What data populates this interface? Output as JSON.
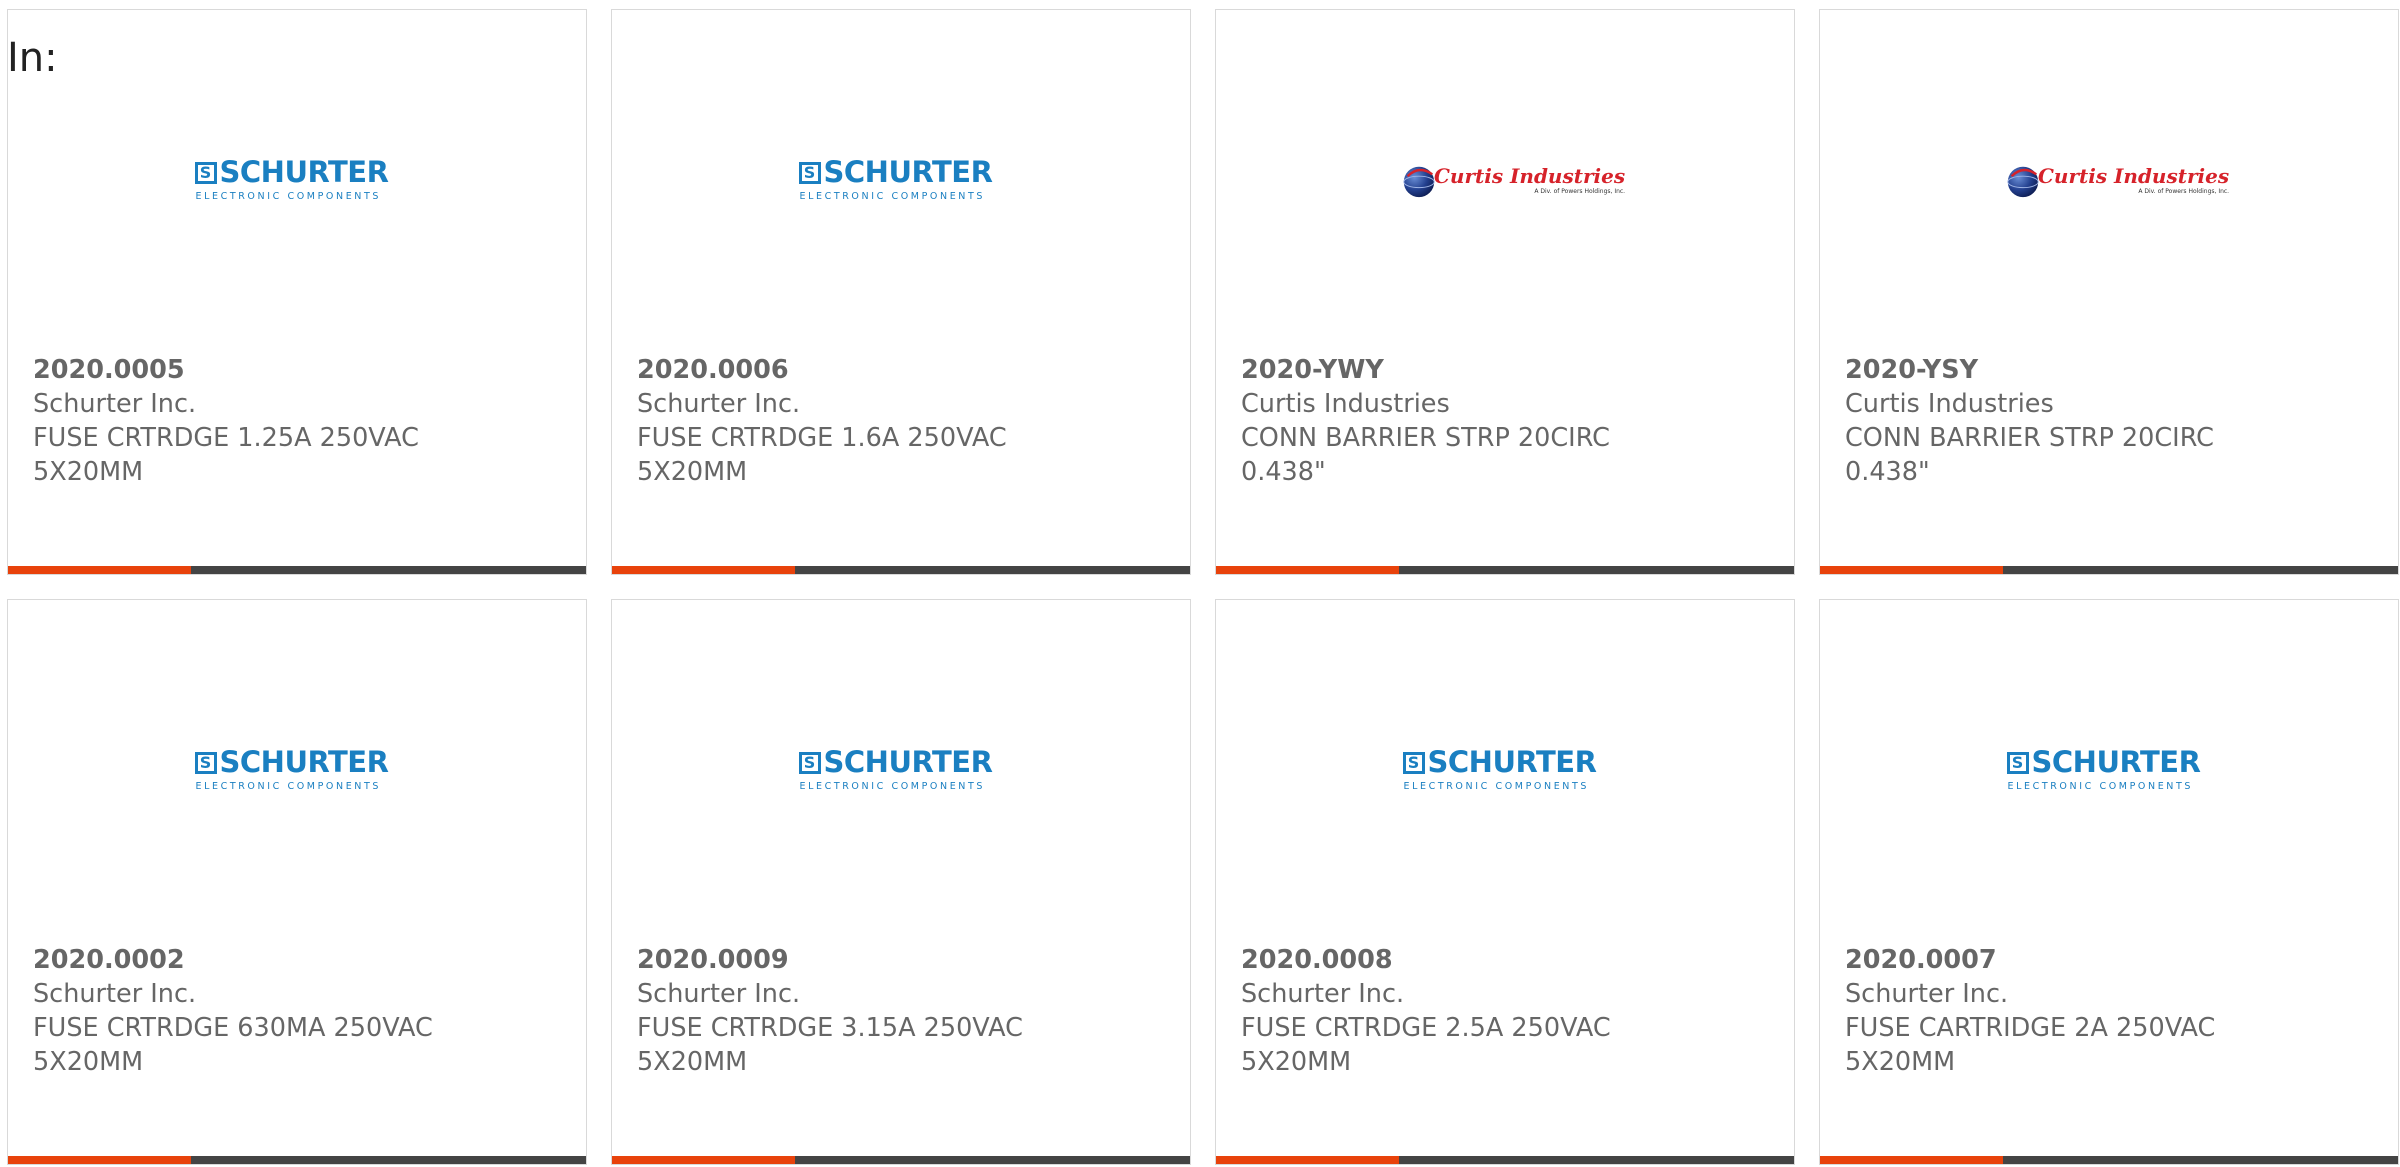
{
  "header": {
    "in_label": "In:"
  },
  "colors": {
    "accent": "#e8420b",
    "bar_dark": "#444444",
    "text": "#666666",
    "schurter_blue": "#1a7fc1",
    "curtis_red": "#d6222a"
  },
  "logos": {
    "schurter": {
      "mark": "S",
      "name": "SCHURTER",
      "tagline": "ELECTRONIC COMPONENTS"
    },
    "curtis": {
      "name": "Curtis Industries",
      "tagline": "A Div. of Powers Holdings, Inc."
    }
  },
  "products": [
    {
      "part_number": "2020.0005",
      "manufacturer": "Schurter Inc.",
      "description": "FUSE CRTRDGE 1.25A 250VAC 5X20MM",
      "logo": "schurter"
    },
    {
      "part_number": "2020.0006",
      "manufacturer": "Schurter Inc.",
      "description": "FUSE CRTRDGE 1.6A 250VAC 5X20MM",
      "logo": "schurter"
    },
    {
      "part_number": "2020-YWY",
      "manufacturer": "Curtis Industries",
      "description": "CONN BARRIER STRP 20CIRC 0.438\"",
      "logo": "curtis"
    },
    {
      "part_number": "2020-YSY",
      "manufacturer": "Curtis Industries",
      "description": "CONN BARRIER STRP 20CIRC 0.438\"",
      "logo": "curtis"
    },
    {
      "part_number": "2020.0002",
      "manufacturer": "Schurter Inc.",
      "description": "FUSE CRTRDGE 630MA 250VAC 5X20MM",
      "logo": "schurter"
    },
    {
      "part_number": "2020.0009",
      "manufacturer": "Schurter Inc.",
      "description": "FUSE CRTRDGE 3.15A 250VAC 5X20MM",
      "logo": "schurter"
    },
    {
      "part_number": "2020.0008",
      "manufacturer": "Schurter Inc.",
      "description": "FUSE CRTRDGE 2.5A 250VAC 5X20MM",
      "logo": "schurter"
    },
    {
      "part_number": "2020.0007",
      "manufacturer": "Schurter Inc.",
      "description": "FUSE CARTRIDGE 2A 250VAC 5X20MM",
      "logo": "schurter"
    }
  ]
}
